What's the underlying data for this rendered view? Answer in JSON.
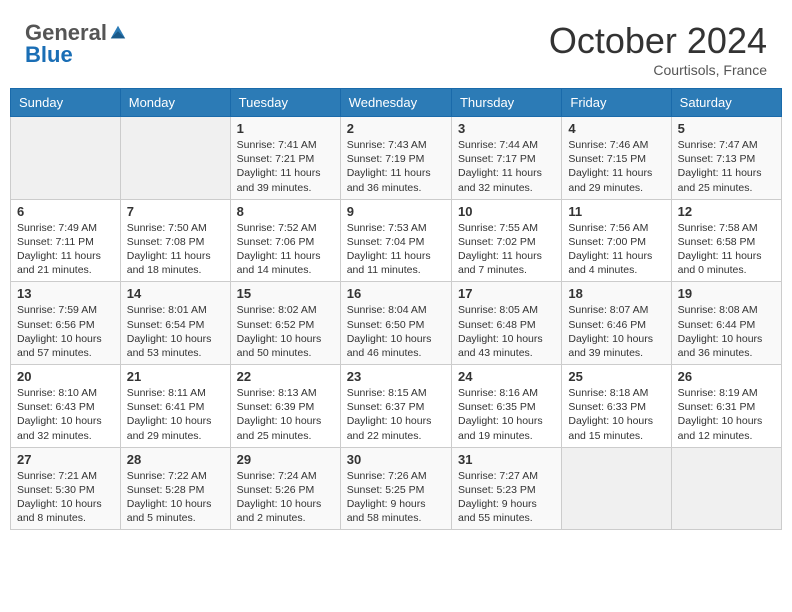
{
  "header": {
    "logo_general": "General",
    "logo_blue": "Blue",
    "month": "October 2024",
    "location": "Courtisols, France"
  },
  "weekdays": [
    "Sunday",
    "Monday",
    "Tuesday",
    "Wednesday",
    "Thursday",
    "Friday",
    "Saturday"
  ],
  "weeks": [
    [
      {
        "day": "",
        "info": ""
      },
      {
        "day": "",
        "info": ""
      },
      {
        "day": "1",
        "info": "Sunrise: 7:41 AM\nSunset: 7:21 PM\nDaylight: 11 hours and 39 minutes."
      },
      {
        "day": "2",
        "info": "Sunrise: 7:43 AM\nSunset: 7:19 PM\nDaylight: 11 hours and 36 minutes."
      },
      {
        "day": "3",
        "info": "Sunrise: 7:44 AM\nSunset: 7:17 PM\nDaylight: 11 hours and 32 minutes."
      },
      {
        "day": "4",
        "info": "Sunrise: 7:46 AM\nSunset: 7:15 PM\nDaylight: 11 hours and 29 minutes."
      },
      {
        "day": "5",
        "info": "Sunrise: 7:47 AM\nSunset: 7:13 PM\nDaylight: 11 hours and 25 minutes."
      }
    ],
    [
      {
        "day": "6",
        "info": "Sunrise: 7:49 AM\nSunset: 7:11 PM\nDaylight: 11 hours and 21 minutes."
      },
      {
        "day": "7",
        "info": "Sunrise: 7:50 AM\nSunset: 7:08 PM\nDaylight: 11 hours and 18 minutes."
      },
      {
        "day": "8",
        "info": "Sunrise: 7:52 AM\nSunset: 7:06 PM\nDaylight: 11 hours and 14 minutes."
      },
      {
        "day": "9",
        "info": "Sunrise: 7:53 AM\nSunset: 7:04 PM\nDaylight: 11 hours and 11 minutes."
      },
      {
        "day": "10",
        "info": "Sunrise: 7:55 AM\nSunset: 7:02 PM\nDaylight: 11 hours and 7 minutes."
      },
      {
        "day": "11",
        "info": "Sunrise: 7:56 AM\nSunset: 7:00 PM\nDaylight: 11 hours and 4 minutes."
      },
      {
        "day": "12",
        "info": "Sunrise: 7:58 AM\nSunset: 6:58 PM\nDaylight: 11 hours and 0 minutes."
      }
    ],
    [
      {
        "day": "13",
        "info": "Sunrise: 7:59 AM\nSunset: 6:56 PM\nDaylight: 10 hours and 57 minutes."
      },
      {
        "day": "14",
        "info": "Sunrise: 8:01 AM\nSunset: 6:54 PM\nDaylight: 10 hours and 53 minutes."
      },
      {
        "day": "15",
        "info": "Sunrise: 8:02 AM\nSunset: 6:52 PM\nDaylight: 10 hours and 50 minutes."
      },
      {
        "day": "16",
        "info": "Sunrise: 8:04 AM\nSunset: 6:50 PM\nDaylight: 10 hours and 46 minutes."
      },
      {
        "day": "17",
        "info": "Sunrise: 8:05 AM\nSunset: 6:48 PM\nDaylight: 10 hours and 43 minutes."
      },
      {
        "day": "18",
        "info": "Sunrise: 8:07 AM\nSunset: 6:46 PM\nDaylight: 10 hours and 39 minutes."
      },
      {
        "day": "19",
        "info": "Sunrise: 8:08 AM\nSunset: 6:44 PM\nDaylight: 10 hours and 36 minutes."
      }
    ],
    [
      {
        "day": "20",
        "info": "Sunrise: 8:10 AM\nSunset: 6:43 PM\nDaylight: 10 hours and 32 minutes."
      },
      {
        "day": "21",
        "info": "Sunrise: 8:11 AM\nSunset: 6:41 PM\nDaylight: 10 hours and 29 minutes."
      },
      {
        "day": "22",
        "info": "Sunrise: 8:13 AM\nSunset: 6:39 PM\nDaylight: 10 hours and 25 minutes."
      },
      {
        "day": "23",
        "info": "Sunrise: 8:15 AM\nSunset: 6:37 PM\nDaylight: 10 hours and 22 minutes."
      },
      {
        "day": "24",
        "info": "Sunrise: 8:16 AM\nSunset: 6:35 PM\nDaylight: 10 hours and 19 minutes."
      },
      {
        "day": "25",
        "info": "Sunrise: 8:18 AM\nSunset: 6:33 PM\nDaylight: 10 hours and 15 minutes."
      },
      {
        "day": "26",
        "info": "Sunrise: 8:19 AM\nSunset: 6:31 PM\nDaylight: 10 hours and 12 minutes."
      }
    ],
    [
      {
        "day": "27",
        "info": "Sunrise: 7:21 AM\nSunset: 5:30 PM\nDaylight: 10 hours and 8 minutes."
      },
      {
        "day": "28",
        "info": "Sunrise: 7:22 AM\nSunset: 5:28 PM\nDaylight: 10 hours and 5 minutes."
      },
      {
        "day": "29",
        "info": "Sunrise: 7:24 AM\nSunset: 5:26 PM\nDaylight: 10 hours and 2 minutes."
      },
      {
        "day": "30",
        "info": "Sunrise: 7:26 AM\nSunset: 5:25 PM\nDaylight: 9 hours and 58 minutes."
      },
      {
        "day": "31",
        "info": "Sunrise: 7:27 AM\nSunset: 5:23 PM\nDaylight: 9 hours and 55 minutes."
      },
      {
        "day": "",
        "info": ""
      },
      {
        "day": "",
        "info": ""
      }
    ]
  ]
}
